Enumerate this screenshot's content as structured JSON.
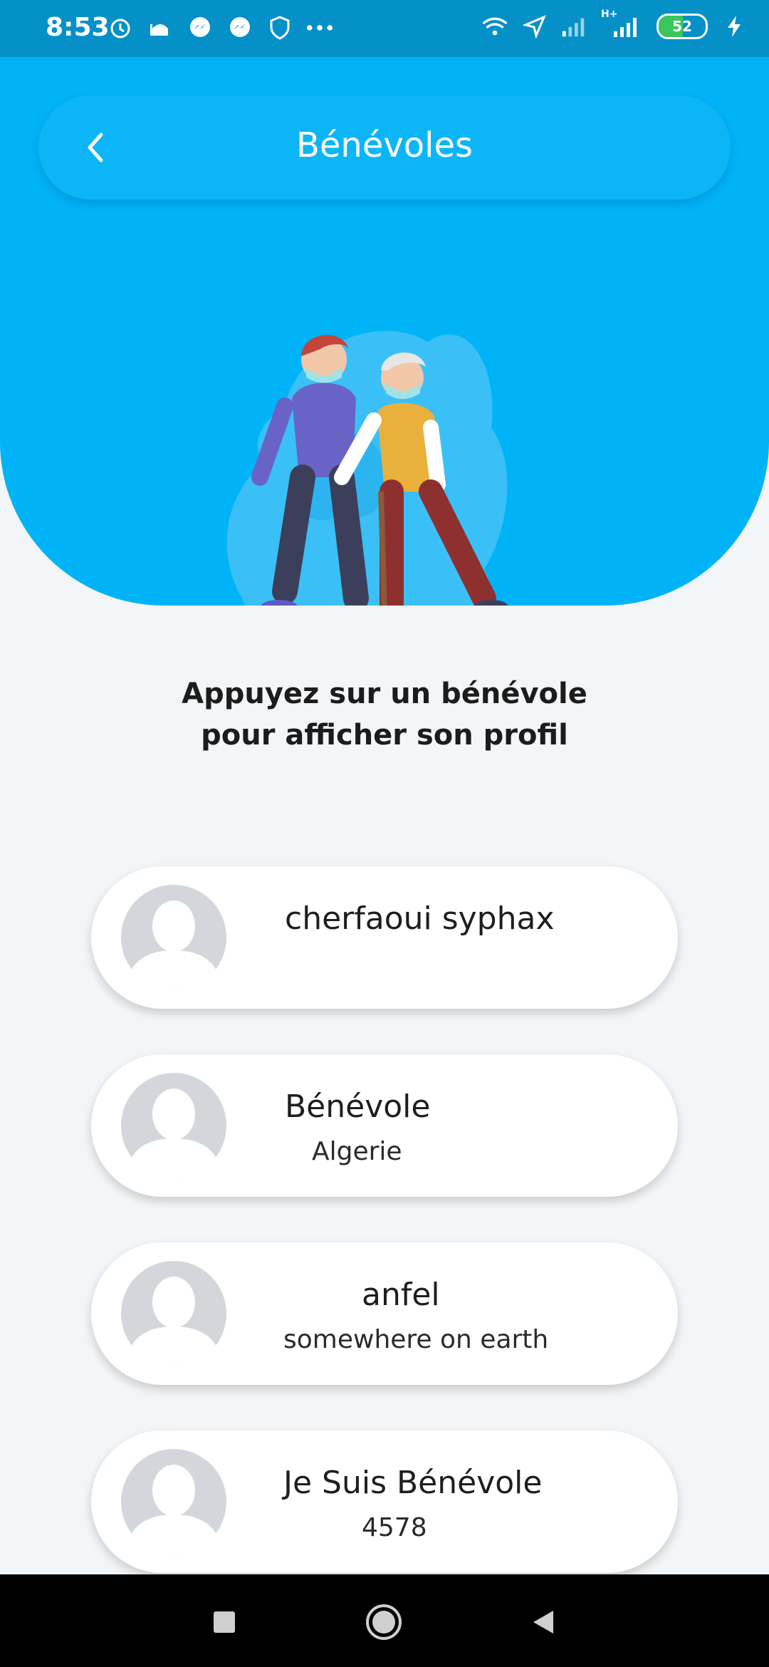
{
  "status_bar": {
    "time": "8:53",
    "left_icons": [
      "alarm-icon",
      "mosque-icon",
      "messenger-icon",
      "messenger-icon",
      "shield-icon",
      "more-dots-icon"
    ],
    "right_icons": [
      "wifi-icon",
      "location-arrow-icon",
      "signal-icon",
      "signal-hplus-icon",
      "battery-icon",
      "charging-bolt-icon"
    ],
    "battery_level": "52",
    "battery_fraction": 0.52,
    "battery_color": "#39c65a",
    "network_label": "H+"
  },
  "header": {
    "title": "Bénévoles",
    "back_icon": "chevron-left-icon",
    "color": "#00b3f7"
  },
  "instruction": {
    "line1": "Appuyez sur un bénévole",
    "line2": "pour afficher son profil"
  },
  "volunteers": [
    {
      "name": "cherfaoui syphax",
      "location": ""
    },
    {
      "name": "Bénévole",
      "location": "Algerie"
    },
    {
      "name": "anfel",
      "location": "somewhere on earth"
    },
    {
      "name": "Je Suis Bénévole",
      "location": "4578"
    }
  ],
  "nav_bar": {
    "icons": [
      "recent-apps-icon",
      "home-icon",
      "back-icon"
    ]
  }
}
